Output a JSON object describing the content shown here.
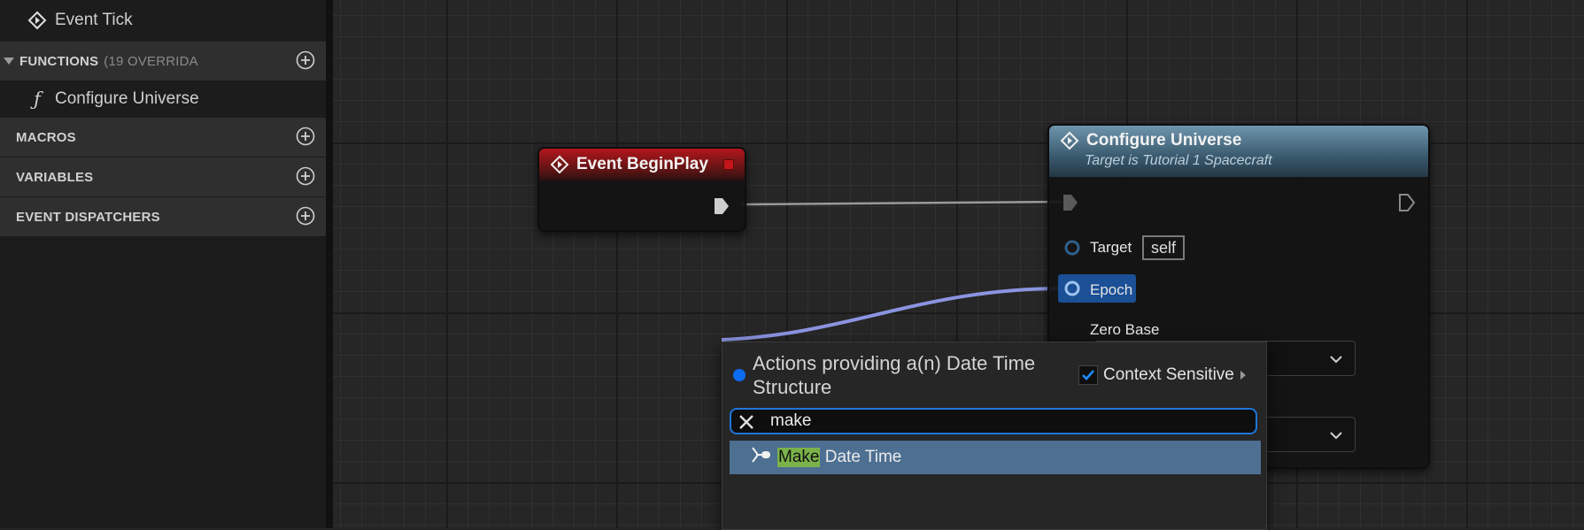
{
  "left_panel": {
    "event_tick_label": "Event Tick",
    "functions_header": "FUNCTIONS",
    "functions_count": "(19 OVERRIDA",
    "function_item": "Configure Universe",
    "macros_header": "MACROS",
    "variables_header": "VARIABLES",
    "dispatchers_header": "EVENT DISPATCHERS"
  },
  "graph": {
    "begin_play": {
      "title": "Event BeginPlay"
    },
    "configure": {
      "title": "Configure Universe",
      "subtitle": "Target is Tutorial 1 Spacecraft",
      "target_label": "Target",
      "target_value": "self",
      "epoch_label": "Epoch",
      "zero_base_label": "Zero Base"
    }
  },
  "action_menu": {
    "title": "Actions providing a(n) Date Time Structure",
    "context_sensitive_label": "Context Sensitive",
    "context_sensitive_checked": true,
    "search_value": "make",
    "result": {
      "highlight": "Make",
      "rest": " Date Time"
    }
  },
  "colors": {
    "accent_blue": "#1e76d8",
    "event_red": "#b1161b",
    "function_blue": "#6e95ad",
    "highlight_green": "#7bb24a",
    "wire_struct": "#8b94e0"
  },
  "icons": {
    "event": "event-diamond-icon",
    "function": "function-icon",
    "add": "add-circle-icon",
    "clear": "close-icon",
    "exec_pin": "exec-pin-icon",
    "chevron": "chevron-down-icon",
    "make_node": "make-node-icon"
  }
}
